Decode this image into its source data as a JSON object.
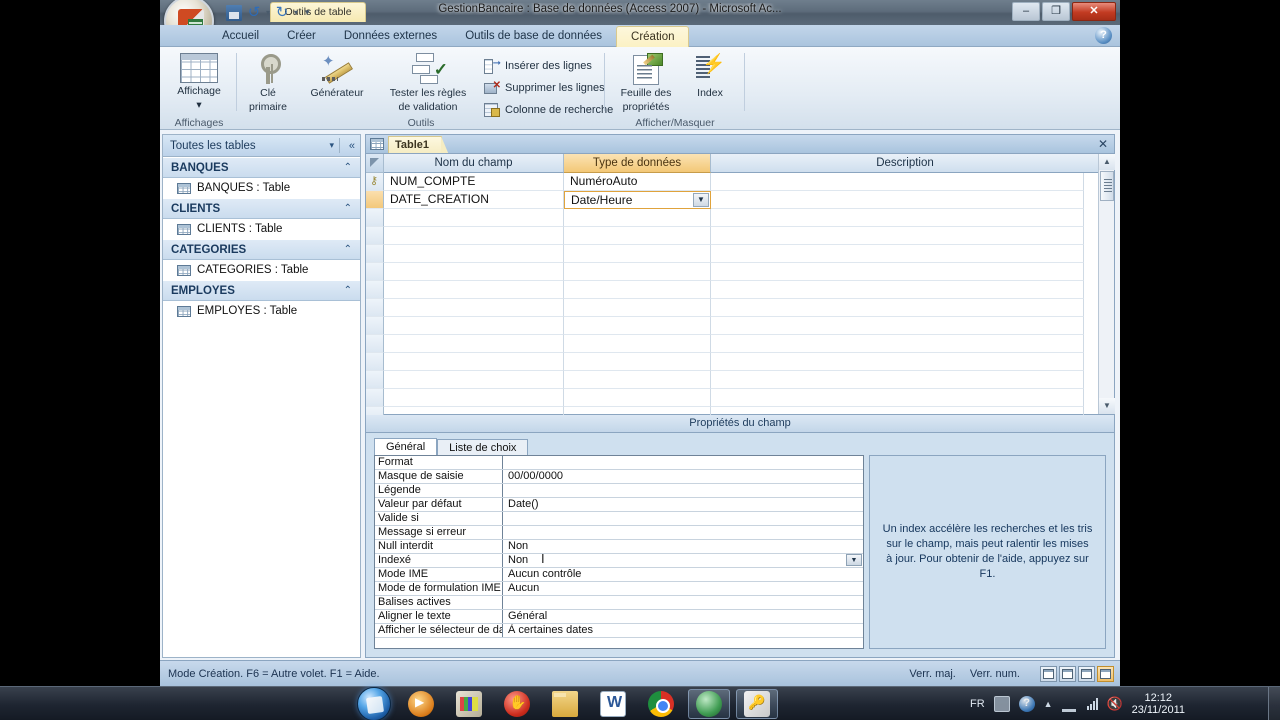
{
  "window": {
    "title": "GestionBancaire : Base de données (Access 2007) - Microsoft Ac...",
    "contextual_tab_title": "Outils de table",
    "minimize": "–",
    "maximize": "❐",
    "close": "✕"
  },
  "quick_access": {
    "save_name": "save-icon",
    "undo": "↺",
    "redo": "↻",
    "caret": "▾",
    "more": "▾"
  },
  "ribbon": {
    "tabs": [
      {
        "label": "Accueil",
        "active": false
      },
      {
        "label": "Créer",
        "active": false
      },
      {
        "label": "Données externes",
        "active": false
      },
      {
        "label": "Outils de base de données",
        "active": false
      },
      {
        "label": "Création",
        "active": true
      }
    ],
    "help_glyph": "?",
    "groups": [
      {
        "label": "Affichages"
      },
      {
        "label": "Outils"
      },
      {
        "label": "Afficher/Masquer"
      }
    ],
    "buttons": {
      "affichage": "Affichage",
      "affichage_caret": "▾",
      "cle_primaire_line1": "Clé",
      "cle_primaire_line2": "primaire",
      "generateur": "Générateur",
      "tester_line1": "Tester les règles",
      "tester_line2": "de validation",
      "inserer_lignes": "Insérer des lignes",
      "supprimer_lignes": "Supprimer les lignes",
      "colonne_recherche": "Colonne de recherche",
      "feuille_prop_line1": "Feuille des",
      "feuille_prop_line2": "propriétés",
      "index": "Index"
    }
  },
  "navpane": {
    "title": "Toutes les tables",
    "caret": "▾",
    "collapse": "«",
    "chevron": "⌃",
    "groups": [
      {
        "name": "BANQUES",
        "items": [
          {
            "label": "BANQUES : Table"
          }
        ]
      },
      {
        "name": "CLIENTS",
        "items": [
          {
            "label": "CLIENTS : Table"
          }
        ]
      },
      {
        "name": "CATEGORIES",
        "items": [
          {
            "label": "CATEGORIES : Table"
          }
        ]
      },
      {
        "name": "EMPLOYES",
        "items": [
          {
            "label": "EMPLOYES : Table"
          }
        ]
      }
    ]
  },
  "document": {
    "tab_label": "Table1",
    "close_glyph": "✕"
  },
  "design_grid": {
    "headers": {
      "field_name": "Nom du champ",
      "data_type": "Type de données",
      "description": "Description"
    },
    "rows": [
      {
        "key": "⚷",
        "field": "NUM_COMPTE",
        "type": "NuméroAuto",
        "description": "",
        "current": false,
        "selected": false
      },
      {
        "key": "",
        "field": "DATE_CREATION",
        "type": "Date/Heure",
        "description": "",
        "current": true,
        "selected": true
      }
    ],
    "empty_row_count": 13,
    "dropdown_glyph": "▼",
    "scroll_up": "▲",
    "scroll_down": "▼"
  },
  "properties": {
    "header": "Propriétés du champ",
    "tabs": [
      {
        "label": "Général",
        "active": true
      },
      {
        "label": "Liste de choix",
        "active": false
      }
    ],
    "rows": [
      {
        "name": "Format",
        "value": ""
      },
      {
        "name": "Masque de saisie",
        "value": "00/00/0000"
      },
      {
        "name": "Légende",
        "value": ""
      },
      {
        "name": "Valeur par défaut",
        "value": "Date()"
      },
      {
        "name": "Valide si",
        "value": ""
      },
      {
        "name": "Message si erreur",
        "value": ""
      },
      {
        "name": "Null interdit",
        "value": "Non"
      },
      {
        "name": "Indexé",
        "value": "Non",
        "focused": true,
        "dropdown": "▼"
      },
      {
        "name": "Mode IME",
        "value": "Aucun contrôle"
      },
      {
        "name": "Mode de formulation IME",
        "value": "Aucun"
      },
      {
        "name": "Balises actives",
        "value": ""
      },
      {
        "name": "Aligner le texte",
        "value": "Général"
      },
      {
        "name": "Afficher le sélecteur de da",
        "value": "À certaines dates"
      }
    ],
    "help_text": "Un index accélère les recherches et les tris sur le champ, mais peut ralentir les mises à jour. Pour obtenir de l'aide, appuyez sur F1."
  },
  "statusbar": {
    "mode_text": "Mode Création. F6 = Autre volet. F1 = Aide.",
    "caps_lock": "Verr. maj.",
    "num_lock": "Verr. num.",
    "view_buttons": [
      {
        "name": "datasheet-view",
        "active": false
      },
      {
        "name": "pivottable-view",
        "active": false
      },
      {
        "name": "pivotchart-view",
        "active": false
      },
      {
        "name": "design-view",
        "active": true
      }
    ]
  },
  "taskbar": {
    "start_name": "start-orb",
    "items": [
      {
        "name": "windows-media-player",
        "running": false
      },
      {
        "name": "paint-app",
        "running": false
      },
      {
        "name": "recording-app",
        "running": false
      },
      {
        "name": "file-explorer",
        "running": false
      },
      {
        "name": "word-app",
        "running": false
      },
      {
        "name": "chrome-browser",
        "running": false
      },
      {
        "name": "green-app",
        "running": true
      },
      {
        "name": "access-app",
        "running": true
      }
    ],
    "tray": {
      "language": "FR",
      "arrow": "▲",
      "help_glyph": "?",
      "time": "12:12",
      "date": "23/11/2011"
    }
  }
}
